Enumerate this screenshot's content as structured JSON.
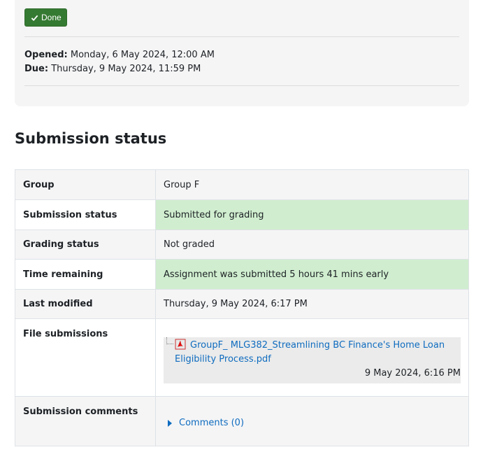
{
  "activity": {
    "done_label": "Done",
    "opened_label": "Opened:",
    "opened_value": "Monday, 6 May 2024, 12:00 AM",
    "due_label": "Due:",
    "due_value": "Thursday, 9 May 2024, 11:59 PM"
  },
  "section_title": "Submission status",
  "rows": {
    "group": {
      "label": "Group",
      "value": "Group F"
    },
    "submission_status": {
      "label": "Submission status",
      "value": "Submitted for grading"
    },
    "grading_status": {
      "label": "Grading status",
      "value": "Not graded"
    },
    "time_remaining": {
      "label": "Time remaining",
      "value": "Assignment was submitted 5 hours 41 mins early"
    },
    "last_modified": {
      "label": "Last modified",
      "value": "Thursday, 9 May 2024, 6:17 PM"
    },
    "file_submissions": {
      "label": "File submissions",
      "file_name": "GroupF_ MLG382_Streamlining BC Finance's Home Loan Eligibility Process.pdf",
      "file_date": "9 May 2024, 6:16 PM"
    },
    "submission_comments": {
      "label": "Submission comments",
      "comments_link": "Comments (0)"
    }
  },
  "colors": {
    "done_button": "#357a32",
    "success_cell": "#d0eecf",
    "link": "#0f6cbf"
  },
  "icons": [
    "check-icon",
    "pdf-file-icon",
    "caret-right-icon"
  ]
}
